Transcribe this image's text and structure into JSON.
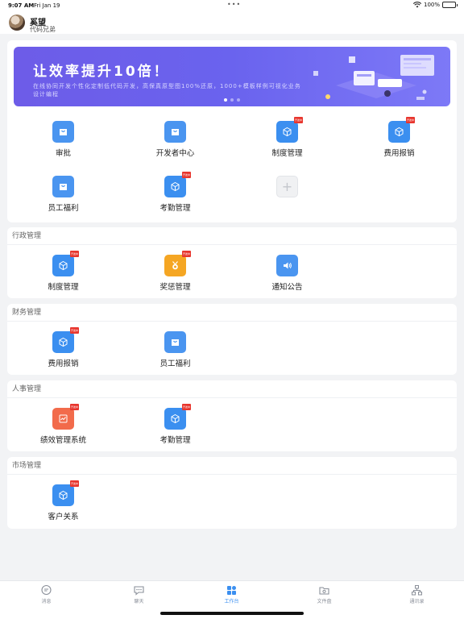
{
  "status": {
    "time": "9:07 AM",
    "date": "Fri Jan 19",
    "battery": "100%"
  },
  "user": {
    "name": "奚望",
    "subtitle": "代码兄弟"
  },
  "banner": {
    "title": "让效率提升10倍！",
    "subtitle": "在线协同开发个性化定制低代码开发，高保真原型图100%还原，1000+模板样例可视化业务设计编程"
  },
  "badge_text": "开发中",
  "top_apps": [
    {
      "label": "审批",
      "icon": "bag-icon",
      "badge": false
    },
    {
      "label": "开发者中心",
      "icon": "bag-icon",
      "badge": false
    },
    {
      "label": "制度管理",
      "icon": "cube-icon",
      "badge": true
    },
    {
      "label": "费用报销",
      "icon": "cube-icon",
      "badge": true
    },
    {
      "label": "员工福利",
      "icon": "bag-icon",
      "badge": false
    },
    {
      "label": "考勤管理",
      "icon": "cube-icon",
      "badge": true
    }
  ],
  "sections": [
    {
      "title": "行政管理",
      "apps": [
        {
          "label": "制度管理",
          "icon": "cube-icon",
          "badge": true
        },
        {
          "label": "奖惩管理",
          "icon": "medal-icon",
          "badge": true
        },
        {
          "label": "通知公告",
          "icon": "speaker-icon",
          "badge": false
        }
      ]
    },
    {
      "title": "财务管理",
      "apps": [
        {
          "label": "费用报销",
          "icon": "cube-icon",
          "badge": true
        },
        {
          "label": "员工福利",
          "icon": "bag-icon",
          "badge": false
        }
      ]
    },
    {
      "title": "人事管理",
      "apps": [
        {
          "label": "绩效管理系统",
          "icon": "chart-icon",
          "badge": true
        },
        {
          "label": "考勤管理",
          "icon": "cube-icon",
          "badge": true
        }
      ]
    },
    {
      "title": "市场管理",
      "apps": [
        {
          "label": "客户关系",
          "icon": "cube-icon",
          "badge": true
        }
      ]
    }
  ],
  "tabs": [
    {
      "label": "消息",
      "icon": "message-icon",
      "active": false
    },
    {
      "label": "聊天",
      "icon": "chat-icon",
      "active": false
    },
    {
      "label": "工作台",
      "icon": "grid-icon",
      "active": true
    },
    {
      "label": "文件盘",
      "icon": "folder-icon",
      "active": false
    },
    {
      "label": "通讯录",
      "icon": "contacts-icon",
      "active": false
    }
  ],
  "colors": {
    "accent": "#3b8ff0",
    "badge": "#e8362e",
    "medal": "#f5a623",
    "chart": "#f26b4b",
    "banner": "#6d5ce8"
  }
}
